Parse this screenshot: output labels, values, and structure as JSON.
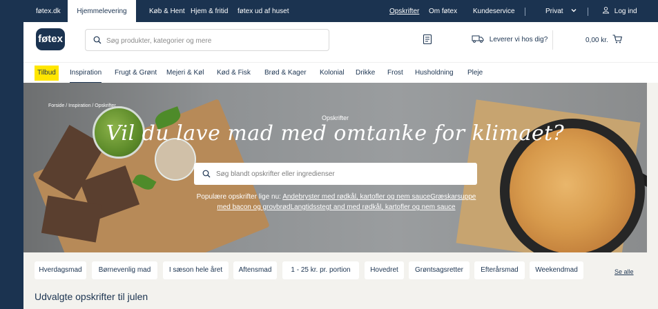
{
  "topbar": {
    "links": [
      "føtex.dk",
      "Hjemmelevering",
      "Køb & Hent",
      "Hjem & fritid",
      "føtex ud af huset"
    ],
    "right": {
      "opskrifter": "Opskrifter",
      "om": "Om føtex",
      "kundeservice": "Kundeservice",
      "privat": "Privat",
      "login": "Log ind"
    }
  },
  "header": {
    "logo": "føtex",
    "search_placeholder": "Søg produkter, kategorier og mere",
    "deliver": "Leverer vi hos dig?",
    "basket": "0,00 kr."
  },
  "nav": {
    "items": [
      "Tilbud",
      "Inspiration",
      "Frugt & Grønt",
      "Mejeri & Køl",
      "Kød & Fisk",
      "Brød & Kager",
      "Kolonial",
      "Drikke",
      "Frost",
      "Husholdning",
      "Pleje"
    ]
  },
  "hero": {
    "breadcrumb": "Forside / Inspiration / Opskrifter",
    "kicker": "Opskrifter",
    "title": "Vil du lave mad med omtanke for klimaet?",
    "search_placeholder": "Søg blandt opskrifter eller ingredienser",
    "popular_prefix": "Populære opskrifter lige nu:",
    "popular_links": [
      "Andebryster med rødkål, kartofler og nem sauce",
      "Græskarsuppe med bacon og grovbrød",
      "Langtidsstegt and med rødkål, kartofler og nem sauce"
    ]
  },
  "chips": {
    "items": [
      "Hverdagsmad",
      "Børnevenlig mad",
      "I sæson hele året",
      "Aftensmad",
      "1 - 25 kr. pr. portion",
      "Hovedret",
      "Grøntsagsretter",
      "Efterårsmad",
      "Weekendmad"
    ],
    "see_all": "Se alle"
  },
  "section": {
    "title": "Udvalgte opskrifter til julen"
  },
  "colors": {
    "navy": "#1b3350",
    "yellow": "#ffe600",
    "background": "#f3f2ee"
  }
}
